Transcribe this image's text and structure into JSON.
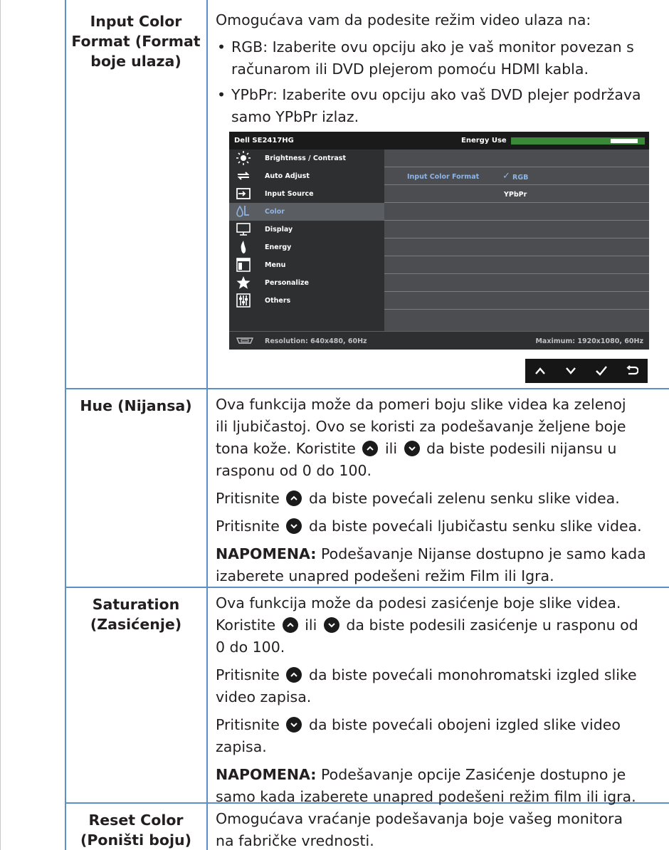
{
  "rows": [
    {
      "label": [
        "Input Color",
        "Format (Format",
        "boje ulaza)"
      ],
      "intro": "Omogućava vam da podesite režim video ulaza na:",
      "bullets": [
        [
          "RGB: Izaberite ovu opciju ako je vaš monitor povezan s",
          "računarom ili DVD plejerom pomoću HDMI kabla."
        ],
        [
          "YPbPr: Izaberite ovu opciju ako vaš DVD plejer podržava",
          "samo YPbPr izlaz."
        ]
      ]
    },
    {
      "label": [
        "Hue (Nijansa)"
      ],
      "p1_lines": [
        "Ova funkcija može da pomeri boju slike videa ka zelenoj",
        "ili ljubičastoj. Ovo se koristi za podešavanje željene boje"
      ],
      "p1_line3_a": "tona kože. Koristite",
      "p1_line3_b": "ili",
      "p1_line3_c": "da biste podesili nijansu u",
      "p1_line4": "rasponu od 0 do 100.",
      "p2_a": "Pritisnite",
      "p2_b": "da biste povećali zelenu senku slike videa.",
      "p3_a": "Pritisnite",
      "p3_b": "da biste povećali ljubičastu senku slike videa.",
      "note_label": "NAPOMENA:",
      "note_line1": "Podešavanje Nijanse dostupno je samo kada",
      "note_line2": "izaberete unapred podešeni režim Film ili Igra."
    },
    {
      "label": [
        "Saturation",
        "(Zasićenje)"
      ],
      "p1_line1": "Ova funkcija može da podesi zasićenje boje slike videa.",
      "p1_line2_a": "Koristite",
      "p1_line2_b": "ili",
      "p1_line2_c": "da biste podesili zasićenje u rasponu od",
      "p1_line3": "0 do 100.",
      "p2_a": "Pritisnite",
      "p2_b": "da biste povećali monohromatski izgled slike",
      "p2_line2": "video zapisa.",
      "p3_a": "Pritisnite",
      "p3_b": "da biste povećali obojeni izgled slike video",
      "p3_line2": "zapisa.",
      "note_label": "NAPOMENA:",
      "note_line1": "Podešavanje opcije Zasićenje dostupno je",
      "note_line2": "samo kada izaberete unapred podešeni režim film ili igra."
    },
    {
      "label": [
        "Reset Color",
        "(Poništi boju)"
      ],
      "lines": [
        "Omogućava vraćanje podešavanja boje vašeg monitora",
        "na fabričke vrednosti."
      ]
    }
  ],
  "osd": {
    "model": "Dell SE2417HG",
    "energy_label": "Energy Use",
    "menu": [
      {
        "label": "Brightness / Contrast",
        "icon": "sun-icon"
      },
      {
        "label": "Auto Adjust",
        "icon": "auto-adjust-icon"
      },
      {
        "label": "Input Source",
        "icon": "input-source-icon"
      },
      {
        "label": "Color",
        "icon": "color-icon"
      },
      {
        "label": "Display",
        "icon": "display-icon"
      },
      {
        "label": "Energy",
        "icon": "energy-icon"
      },
      {
        "label": "Menu",
        "icon": "menu-icon"
      },
      {
        "label": "Personalize",
        "icon": "star-icon"
      },
      {
        "label": "Others",
        "icon": "others-icon"
      }
    ],
    "active_index": 3,
    "submenu_label": "Input Color Format",
    "options": [
      "RGB",
      "YPbPr"
    ],
    "selected_option": "RGB",
    "checkmark": "✓",
    "resolution": "Resolution: 640x480, 60Hz",
    "maximum": "Maximum: 1920x1080, 60Hz",
    "buttons": [
      "up-icon",
      "down-icon",
      "check-icon",
      "back-icon"
    ]
  },
  "bullet_char": "•"
}
